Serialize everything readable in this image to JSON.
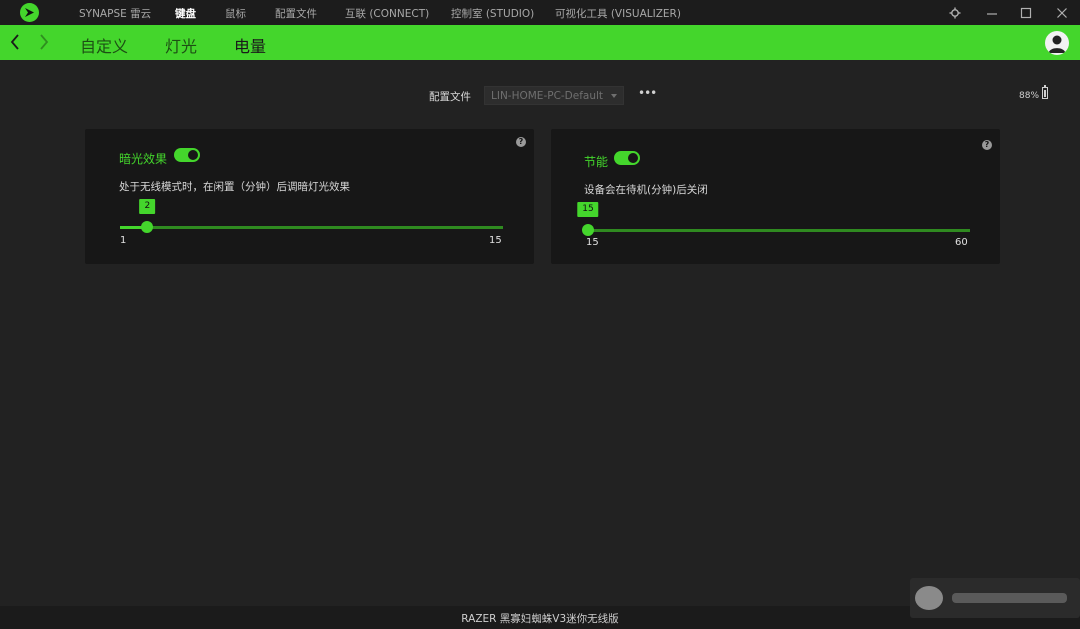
{
  "colors": {
    "accent": "#44d62c",
    "background": "#222222",
    "card": "#171717"
  },
  "top_nav": {
    "items": [
      {
        "label": "SYNAPSE 雷云",
        "active": false
      },
      {
        "label": "键盘",
        "active": true
      },
      {
        "label": "鼠标",
        "active": false
      },
      {
        "label": "配置文件",
        "active": false
      },
      {
        "label": "互联 (CONNECT)",
        "active": false
      },
      {
        "label": "控制室 (STUDIO)",
        "active": false
      },
      {
        "label": "可视化工具 (VISUALIZER)",
        "active": false
      }
    ],
    "window_controls": [
      "settings-icon",
      "minimize-icon",
      "maximize-icon",
      "close-icon"
    ]
  },
  "sub_nav": {
    "tabs": [
      {
        "label": "自定义",
        "active": false
      },
      {
        "label": "灯光",
        "active": false
      },
      {
        "label": "电量",
        "active": true
      }
    ]
  },
  "profile": {
    "label": "配置文件",
    "selected": "LIN-HOME-PC-Default",
    "more_label": "•••"
  },
  "battery": {
    "percent_text": "88%",
    "level": 0.88
  },
  "cards": {
    "dim": {
      "title": "暗光效果",
      "enabled": true,
      "description": "处于无线模式时，在闲置（分钟）后调暗灯光效果",
      "slider": {
        "value": 2,
        "min": 1,
        "max": 15,
        "value_label": "2",
        "min_label": "1",
        "max_label": "15"
      }
    },
    "power": {
      "title": "节能",
      "enabled": true,
      "description": "设备会在待机(分钟)后关闭",
      "slider": {
        "value": 15,
        "min": 15,
        "max": 60,
        "value_label": "15",
        "min_label": "15",
        "max_label": "60"
      }
    }
  },
  "help_label": "?",
  "footer": {
    "device_name": "RAZER 黑寡妇蜘蛛V3迷你无线版"
  }
}
